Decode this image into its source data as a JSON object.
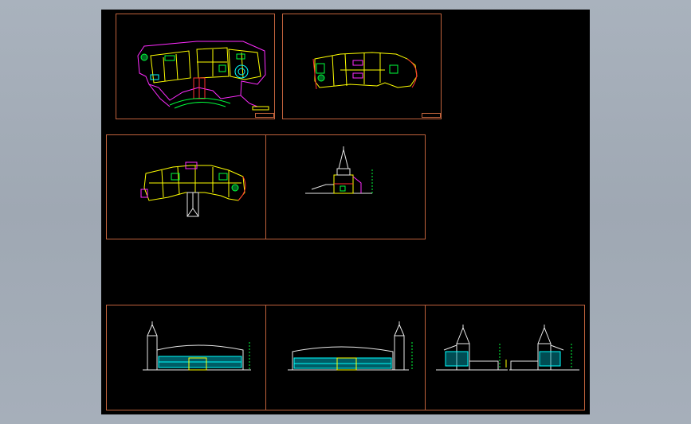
{
  "viewer": {
    "background": "#a9b2bd",
    "canvas": "#000000"
  },
  "drawing": {
    "frame_color": "#c0623c",
    "line_colors": {
      "wall": "#ff2cff",
      "room": "#ffff00",
      "green": "#00ff3c",
      "cyan": "#00ffff",
      "red": "#ff3030",
      "white": "#ffffff"
    },
    "panels": [
      {
        "id": "plan-1",
        "caption": "",
        "titleblock": "",
        "stamp": ""
      },
      {
        "id": "plan-2",
        "caption": "",
        "titleblock": ""
      },
      {
        "id": "plan-3",
        "caption": ""
      },
      {
        "id": "section-1",
        "caption": ""
      },
      {
        "id": "elevation-1",
        "caption": ""
      },
      {
        "id": "elevation-2",
        "caption": ""
      },
      {
        "id": "elevation-3",
        "caption": ""
      }
    ]
  }
}
